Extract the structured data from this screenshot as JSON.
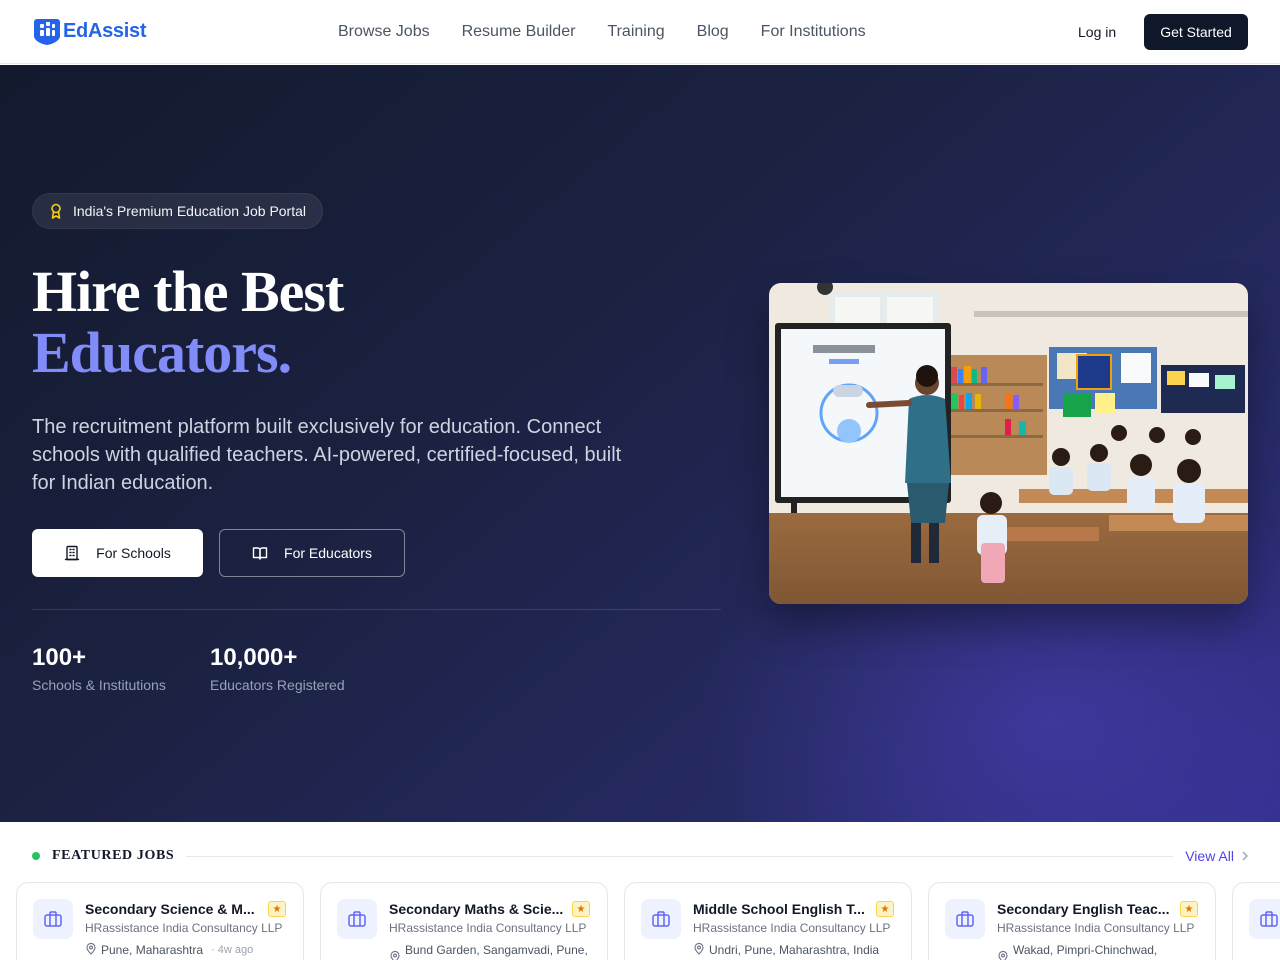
{
  "brand": {
    "name": "EdAssist",
    "color": "#2563eb"
  },
  "nav": {
    "links": [
      "Browse Jobs",
      "Resume Builder",
      "Training",
      "Blog",
      "For Institutions"
    ],
    "login": "Log in",
    "cta": "Get Started"
  },
  "hero": {
    "badge": "India's Premium Education Job Portal",
    "title_line1": "Hire the Best",
    "title_line2": "Educators.",
    "lead": "The recruitment platform built exclusively for education. Connect schools with qualified teachers. AI-powered, certified-focused, built for Indian education.",
    "btn_schools": "For Schools",
    "btn_educators": "For Educators",
    "stats": [
      {
        "value": "100+",
        "label": "Schools & Institutions"
      },
      {
        "value": "10,000+",
        "label": "Educators Registered"
      }
    ],
    "accent": "#818cf8"
  },
  "featured": {
    "title": "FEATURED JOBS",
    "view_all": "View All",
    "jobs": [
      {
        "title": "Secondary Science & M...",
        "company": "HRassistance India Consultancy LLP",
        "location": "Pune, Maharashtra",
        "posted": "4w ago"
      },
      {
        "title": "Secondary Maths & Scie...",
        "company": "HRassistance India Consultancy LLP",
        "location": "Bund Garden, Sangamvadi, Pune,",
        "posted": ""
      },
      {
        "title": "Middle School English T...",
        "company": "HRassistance India Consultancy LLP",
        "location": "Undri, Pune, Maharashtra, India",
        "posted": ""
      },
      {
        "title": "Secondary English Teac...",
        "company": "HRassistance India Consultancy LLP",
        "location": "Wakad, Pimpri-Chinchwad,",
        "posted": ""
      }
    ]
  }
}
